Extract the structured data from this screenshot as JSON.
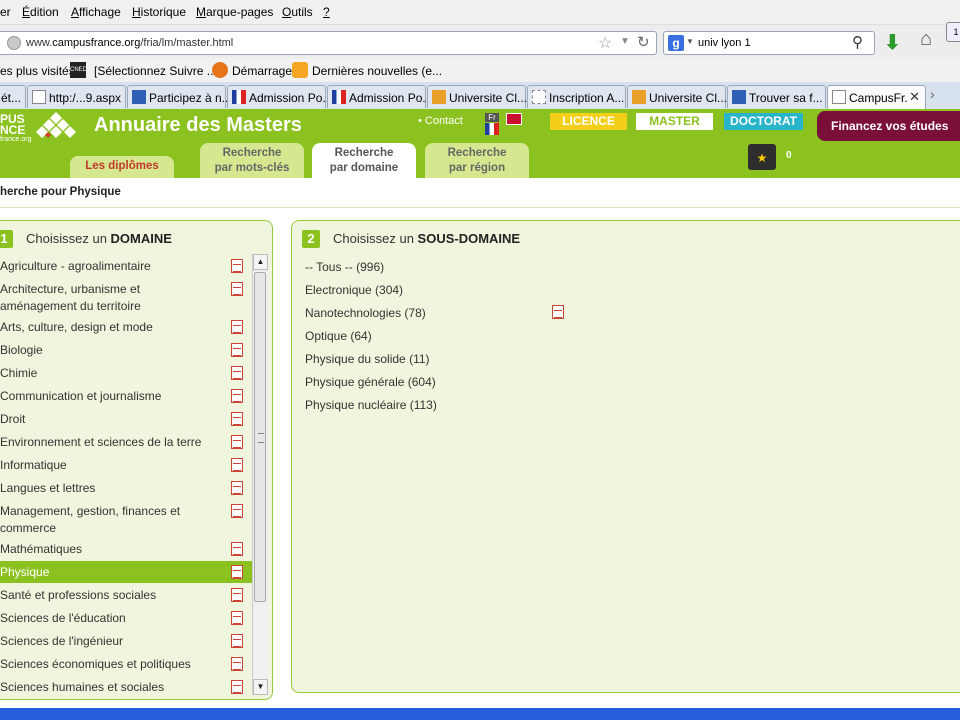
{
  "browser": {
    "menu": [
      {
        "label": "er",
        "underline": ""
      },
      {
        "label": "dition",
        "underline": "É"
      },
      {
        "label": "ffichage",
        "underline": "A"
      },
      {
        "label": "istorique",
        "underline": "H"
      },
      {
        "label": "arque-pages",
        "underline": "M"
      },
      {
        "label": "utils",
        "underline": "O"
      },
      {
        "label": "",
        "underline": "?"
      }
    ],
    "url_prefix": "www.",
    "url_domain": "campusfrance.org",
    "url_path": "/fria/lm/master.html",
    "search_value": "univ lyon 1",
    "search_engine_icon": "google-icon",
    "bookmarks": [
      "es plus visités",
      "[Sélectionnez Suivre ...",
      "Démarrage",
      "Dernières nouvelles (e..."
    ],
    "tabs": [
      {
        "label": "ét..."
      },
      {
        "label": "http:/...9.aspx"
      },
      {
        "label": "Participez à n..."
      },
      {
        "label": "Admission Po..."
      },
      {
        "label": "Admission Po..."
      },
      {
        "label": "Universite Cl..."
      },
      {
        "label": "Inscription A..."
      },
      {
        "label": "Universite Cl..."
      },
      {
        "label": "Trouver sa f..."
      },
      {
        "label": "CampusFr..."
      }
    ],
    "close_glyph": "✕",
    "scroll_glyph": "›"
  },
  "site": {
    "logo_line1": "PUS",
    "logo_line2": "NCE",
    "logo_sub": "france.org",
    "title": "Annuaire des Masters",
    "contact": "• Contact",
    "lang_fr": "Fr",
    "levels": {
      "licence": "LICENCE",
      "master": "MASTER",
      "doctorat": "DOCTORAT"
    },
    "finance": "Financez vos études",
    "nav": {
      "diplomes": "Les diplômes",
      "motscles_1": "Recherche",
      "motscles_2": "par mots-clés",
      "domaine_1": "Recherche",
      "domaine_2": "par domaine",
      "region_1": "Recherche",
      "region_2": "par région"
    },
    "basket_count": "0"
  },
  "breadcrumb": "herche pour Physique",
  "panel1": {
    "step": "1",
    "title_prefix": "Choisissez un ",
    "title_strong": "DOMAINE",
    "selected": "Physique",
    "domains": [
      {
        "label": "Agriculture - agroalimentaire"
      },
      {
        "label": "Architecture, urbanisme et aménagement du territoire"
      },
      {
        "label": "Arts, culture, design et mode"
      },
      {
        "label": "Biologie"
      },
      {
        "label": "Chimie"
      },
      {
        "label": "Communication et journalisme"
      },
      {
        "label": "Droit"
      },
      {
        "label": "Environnement et sciences de la terre"
      },
      {
        "label": "Informatique"
      },
      {
        "label": "Langues et lettres"
      },
      {
        "label": "Management, gestion, finances et commerce"
      },
      {
        "label": "Mathématiques"
      },
      {
        "label": "Physique"
      },
      {
        "label": "Santé et professions sociales"
      },
      {
        "label": "Sciences de l'éducation"
      },
      {
        "label": "Sciences de l'ingénieur"
      },
      {
        "label": "Sciences économiques et politiques"
      },
      {
        "label": "Sciences humaines et sociales"
      }
    ]
  },
  "panel2": {
    "step": "2",
    "title_prefix": "Choisissez un ",
    "title_strong": "SOUS-DOMAINE",
    "subdomains": [
      "-- Tous -- (996)",
      "Electronique (304)",
      "Nanotechnologies (78)",
      "Optique (64)",
      "Physique du solide (11)",
      "Physique générale (604)",
      "Physique nucléaire (113)"
    ]
  },
  "colors": {
    "brand_green": "#8cc220",
    "licence": "#f4cf19",
    "doctorat": "#28b4c9",
    "finance": "#7a0f3a"
  }
}
